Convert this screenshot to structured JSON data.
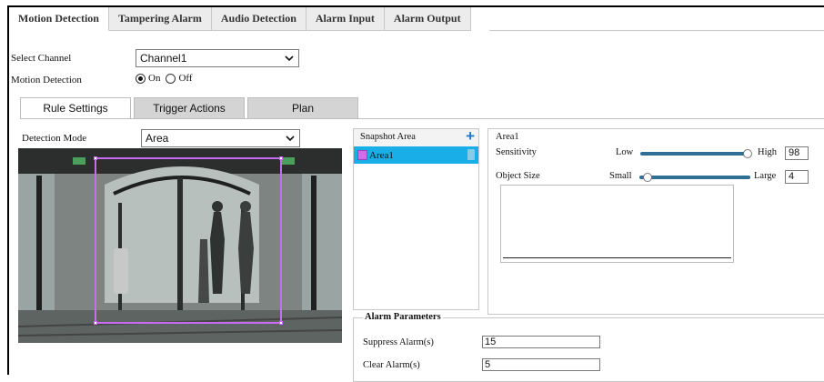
{
  "top_tabs": [
    {
      "label": "Motion Detection",
      "active": true
    },
    {
      "label": "Tampering Alarm",
      "active": false
    },
    {
      "label": "Audio Detection",
      "active": false
    },
    {
      "label": "Alarm Input",
      "active": false
    },
    {
      "label": "Alarm Output",
      "active": false
    }
  ],
  "channel": {
    "label": "Select Channel",
    "value": "Channel1"
  },
  "motion_detection": {
    "label": "Motion Detection",
    "on_label": "On",
    "off_label": "Off",
    "selected": "On"
  },
  "sub_tabs": [
    {
      "label": "Rule Settings",
      "active": true
    },
    {
      "label": "Trigger Actions",
      "active": false
    },
    {
      "label": "Plan",
      "active": false
    }
  ],
  "detection_mode": {
    "label": "Detection Mode",
    "value": "Area"
  },
  "snapshot": {
    "header": "Snapshot Area",
    "items": [
      {
        "name": "Area1"
      }
    ]
  },
  "area_settings": {
    "title": "Area1",
    "sensitivity": {
      "label": "Sensitivity",
      "min_label": "Low",
      "max_label": "High",
      "value": "98"
    },
    "object_size": {
      "label": "Object Size",
      "min_label": "Small",
      "max_label": "Large",
      "value": "4"
    }
  },
  "alarm_parameters": {
    "legend": "Alarm Parameters",
    "suppress": {
      "label": "Suppress Alarm(s)",
      "value": "15"
    },
    "clear": {
      "label": "Clear Alarm(s)",
      "value": "5"
    }
  },
  "icons": {
    "add": "plus-icon",
    "delete": "trash-icon",
    "dropdown": "chevron-down-icon"
  },
  "colors": {
    "selected_row": "#19aee8",
    "area_outline": "#c76cf0",
    "slider_track": "#2f6e95",
    "add_icon": "#1e7ac8"
  }
}
